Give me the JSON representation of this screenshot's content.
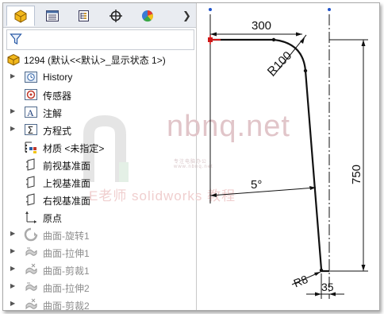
{
  "feature_tree": {
    "root_label": "1294  (默认<<默认>_显示状态 1>)",
    "items": [
      {
        "label": "History",
        "icon": "history-icon",
        "expandable": true,
        "dimmed": false
      },
      {
        "label": "传感器",
        "icon": "sensor-icon",
        "expandable": false,
        "dimmed": false
      },
      {
        "label": "注解",
        "icon": "annotation-icon",
        "expandable": true,
        "dimmed": false
      },
      {
        "label": "方程式",
        "icon": "equation-icon",
        "expandable": true,
        "dimmed": false
      },
      {
        "label": "材质 <未指定>",
        "icon": "material-icon",
        "expandable": false,
        "dimmed": false
      },
      {
        "label": "前视基准面",
        "icon": "plane-icon",
        "expandable": false,
        "dimmed": false
      },
      {
        "label": "上视基准面",
        "icon": "plane-icon",
        "expandable": false,
        "dimmed": false
      },
      {
        "label": "右视基准面",
        "icon": "plane-icon",
        "expandable": false,
        "dimmed": false
      },
      {
        "label": "原点",
        "icon": "origin-icon",
        "expandable": false,
        "dimmed": false
      },
      {
        "label": "曲面-旋转1",
        "icon": "revolve-surface-icon",
        "expandable": true,
        "dimmed": true
      },
      {
        "label": "曲面-拉伸1",
        "icon": "extrude-surface-icon",
        "expandable": true,
        "dimmed": true
      },
      {
        "label": "曲面-剪裁1",
        "icon": "trim-surface-icon",
        "expandable": true,
        "dimmed": true
      },
      {
        "label": "曲面-拉伸2",
        "icon": "extrude-surface-icon",
        "expandable": true,
        "dimmed": true
      },
      {
        "label": "曲面-剪裁2",
        "icon": "trim-surface-icon",
        "expandable": true,
        "dimmed": true
      }
    ]
  },
  "sketch": {
    "dim_width": "300",
    "dim_radius_top": "R100",
    "dim_angle": "5°",
    "dim_height": "750",
    "dim_radius_bottom": "R8",
    "dim_bottom_width": "35"
  },
  "watermark": {
    "site": "nbnq.net",
    "subline": "专注电脑办公 · www.nbnq.net",
    "text": "E老师 solidworks 教程"
  },
  "colors": {
    "tab_bar": "#e9ecf1",
    "dim_blue": "#2255cc",
    "sketch_black": "#111111",
    "origin_red": "#d01818"
  }
}
